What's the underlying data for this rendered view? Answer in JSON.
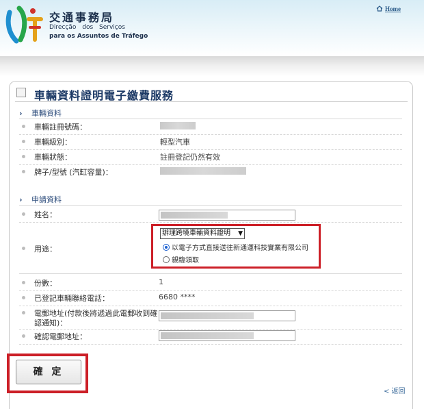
{
  "header": {
    "org_cn": "交通事務局",
    "org_pt_line1": "Direcção dos Serviços",
    "org_pt_line2": "para os Assuntos de Tráfego",
    "home_label": "Home"
  },
  "page": {
    "title": "車輛資料證明電子繳費服務"
  },
  "vehicle_section": {
    "heading": "車輛資料",
    "rows": [
      {
        "label": "車輛註冊號碼：",
        "value": ""
      },
      {
        "label": "車輛級別：",
        "value": "輕型汽車"
      },
      {
        "label": "車輛狀態：",
        "value": "註冊登記仍然有效"
      },
      {
        "label": "牌子/型號 (汽缸容量)：",
        "value": ""
      }
    ]
  },
  "application_section": {
    "heading": "申請資料",
    "name_label": "姓名：",
    "purpose_label": "用途：",
    "purpose_selected": "辦理跨境車輛資料證明",
    "delivery_options": [
      {
        "label": "以電子方式直接送往新通運科技實業有限公司",
        "selected": true
      },
      {
        "label": "親臨領取",
        "selected": false
      }
    ],
    "copies_label": "份數：",
    "copies_value": "1",
    "phone_label": "已登記車輛聯絡電話：",
    "phone_value": "6680 ****",
    "email_label_line1": "電郵地址(付款後將遞過此電郵收到確",
    "email_label_line2": "認通知)：",
    "confirm_email_label": "確認電郵地址："
  },
  "actions": {
    "confirm_label": "確 定",
    "back_label": "< 返回"
  },
  "colors": {
    "highlight": "#cc1f27",
    "title": "#1d3a66",
    "radio_selected": "#1a5fd0"
  }
}
